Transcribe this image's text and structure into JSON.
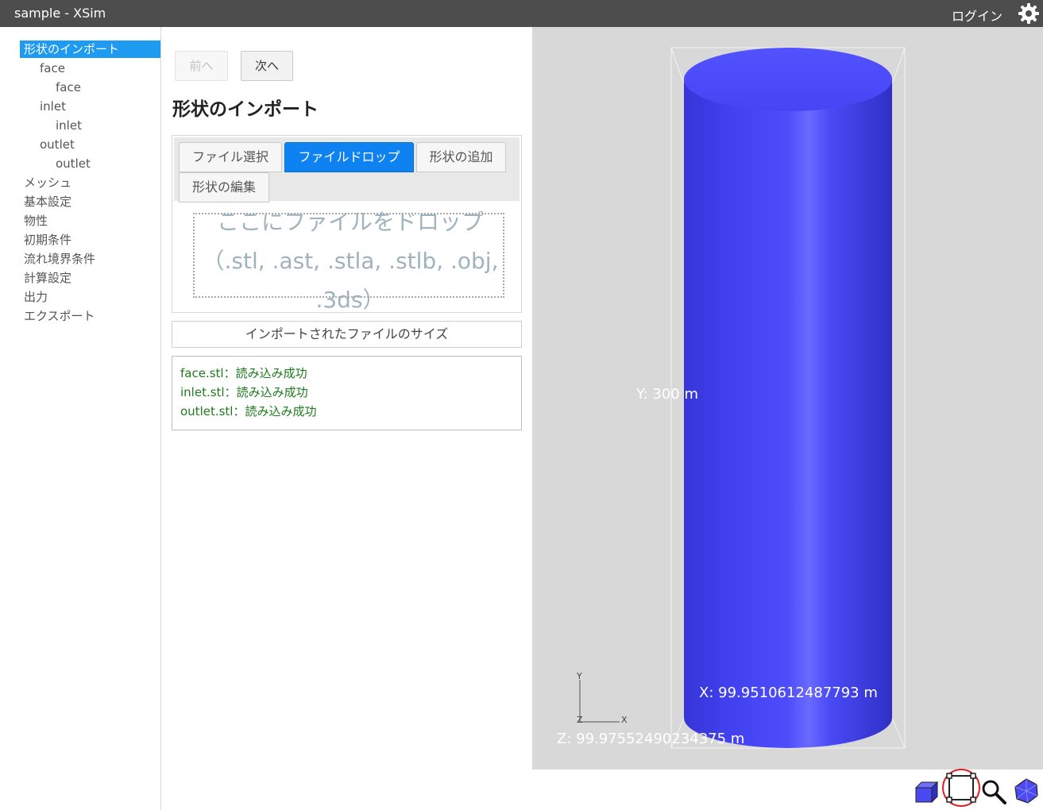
{
  "window": {
    "title": "sample - XSim",
    "login_label": "ログイン",
    "settings_icon": "gear-icon"
  },
  "sidebar": {
    "items": [
      {
        "label": "形状のインポート",
        "selected": true
      },
      {
        "label": "face"
      },
      {
        "label": "face"
      },
      {
        "label": "inlet"
      },
      {
        "label": "inlet"
      },
      {
        "label": "outlet"
      },
      {
        "label": "outlet"
      },
      {
        "label": "メッシュ"
      },
      {
        "label": "基本設定"
      },
      {
        "label": "物性"
      },
      {
        "label": "初期条件"
      },
      {
        "label": "流れ境界条件"
      },
      {
        "label": "計算設定"
      },
      {
        "label": "出力"
      },
      {
        "label": "エクスポート"
      }
    ]
  },
  "panel": {
    "prev_label": "前へ",
    "next_label": "次へ",
    "title": "形状のインポート",
    "tabs": [
      "ファイル選択",
      "ファイルドロップ",
      "形状の追加",
      "形状の編集"
    ],
    "active_tab": "ファイルドロップ",
    "drop_text": "ここにファイルをドロップ（.stl, .ast, .stla, .stlb, .obj, .3ds）",
    "size_button_label": "インポートされたファイルのサイズ",
    "log": [
      "face.stl：読み込み成功",
      "inlet.stl：読み込み成功",
      "outlet.stl：読み込み成功"
    ]
  },
  "viewer": {
    "y_dimension": "Y: 300 m",
    "x_dimension": "X: 99.9510612487793 m",
    "z_dimension": "Z: 99.97552490234375 m",
    "axis_y": "Y",
    "axis_x": "X",
    "axis_z": "Z",
    "shape_color": "#4444f2",
    "background_color": "#d8d8d8"
  },
  "toolbar": {
    "tools": [
      "cube-view-icon",
      "bounding-box-icon",
      "zoom-icon",
      "mesh-view-icon"
    ],
    "highlighted_tool": "bounding-box-icon"
  }
}
